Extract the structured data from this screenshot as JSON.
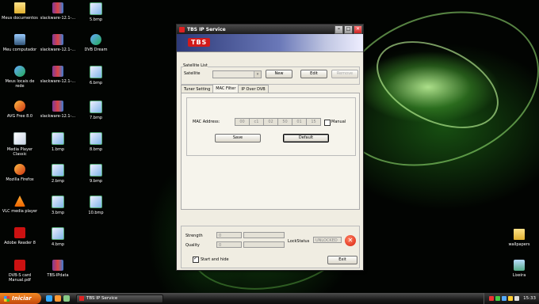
{
  "desktop": {
    "icons": [
      {
        "label": "Meus documentos",
        "kind": "folder"
      },
      {
        "label": "slackware-12.1-...",
        "kind": "rar"
      },
      {
        "label": "5.bmp",
        "kind": "bmp"
      },
      {
        "label": "Meu computador",
        "kind": "pc"
      },
      {
        "label": "slackware-12.1-...",
        "kind": "rar"
      },
      {
        "label": "DVB Dream",
        "kind": "net"
      },
      {
        "label": "Meus locais de rede",
        "kind": "net"
      },
      {
        "label": "slackware-12.1-...",
        "kind": "rar"
      },
      {
        "label": "6.bmp",
        "kind": "bmp"
      },
      {
        "label": "AVG Free 8.0",
        "kind": "app"
      },
      {
        "label": "slackware-12.1-...",
        "kind": "rar"
      },
      {
        "label": "7.bmp",
        "kind": "bmp"
      },
      {
        "label": "Media Player Classic",
        "kind": "doc"
      },
      {
        "label": "1.bmp",
        "kind": "bmp"
      },
      {
        "label": "8.bmp",
        "kind": "bmp"
      },
      {
        "label": "Mozilla Firefox",
        "kind": "app"
      },
      {
        "label": "2.bmp",
        "kind": "bmp"
      },
      {
        "label": "9.bmp",
        "kind": "bmp"
      },
      {
        "label": "VLC media player",
        "kind": "vlc"
      },
      {
        "label": "3.bmp",
        "kind": "bmp"
      },
      {
        "label": "10.bmp",
        "kind": "bmp"
      },
      {
        "label": "Adobe Reader 8",
        "kind": "pdf"
      },
      {
        "label": "4.bmp",
        "kind": "bmp"
      },
      {
        "label": "DVB-S card Manual.pdf",
        "kind": "pdf"
      },
      {
        "label": "TBS-IPdata",
        "kind": "rar"
      },
      {
        "label": "wallpapers",
        "kind": "folder"
      },
      {
        "label": "Lixeira",
        "kind": "recycle"
      }
    ]
  },
  "window": {
    "title": "TBS IP Service",
    "logo": "TBS",
    "satellite_list": {
      "group_label": "Satellite List",
      "satellite_label": "Satellite",
      "satellite_value": "",
      "new_label": "New",
      "edit_label": "Edit",
      "remove_label": "Remove"
    },
    "tabs": [
      "Tuner Setting",
      "MAC Filter",
      "IP Over DVB"
    ],
    "active_tab": "MAC Filter",
    "mac": {
      "label": "MAC Address:",
      "octets": [
        "00",
        "c1",
        "02",
        "50",
        "01",
        "15"
      ],
      "manual_label": "Manual",
      "manual_checked": false,
      "save_label": "Save",
      "default_label": "Default"
    },
    "status": {
      "strength_label": "Strength",
      "strength_value": "0",
      "quality_label": "Quality",
      "quality_value": "0",
      "lockstatus_label": "LockStatus",
      "lockstatus_value": "UNLOCKED",
      "start_hide_label": "Start and hide",
      "start_hide_checked": true,
      "exit_label": "Exit"
    }
  },
  "taskbar": {
    "start_label": "Iniciar",
    "task_item": "TBS IP Service",
    "clock": "15:33"
  }
}
